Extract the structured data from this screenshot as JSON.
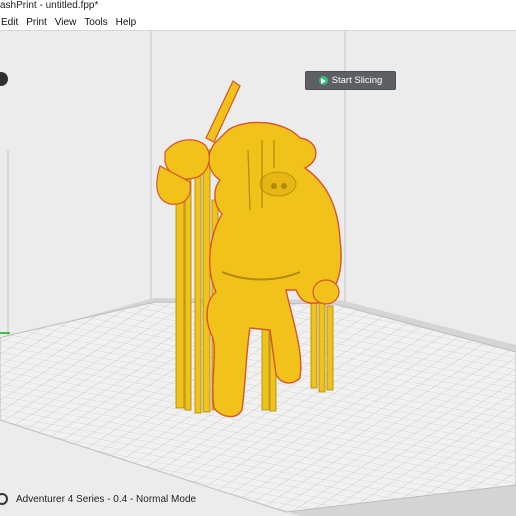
{
  "window": {
    "title": "ashPrint - untitled.fpp*"
  },
  "menu": {
    "items": [
      "Edit",
      "Print",
      "View",
      "Tools",
      "Help"
    ]
  },
  "toolbar": {
    "start_slicing_label": "Start Slicing"
  },
  "status": {
    "printer_info": "Adventurer 4 Series - 0.4 - Normal Mode"
  },
  "colors": {
    "model": "#f0c21a",
    "model_outline": "#d9542a",
    "accent_play": "#2fbf71",
    "slice_button": "#5c5f63"
  },
  "icons": {
    "start_slicing": "play-icon",
    "left_toolbar": "toolbar-circle-icon",
    "status": "gear-icon"
  }
}
